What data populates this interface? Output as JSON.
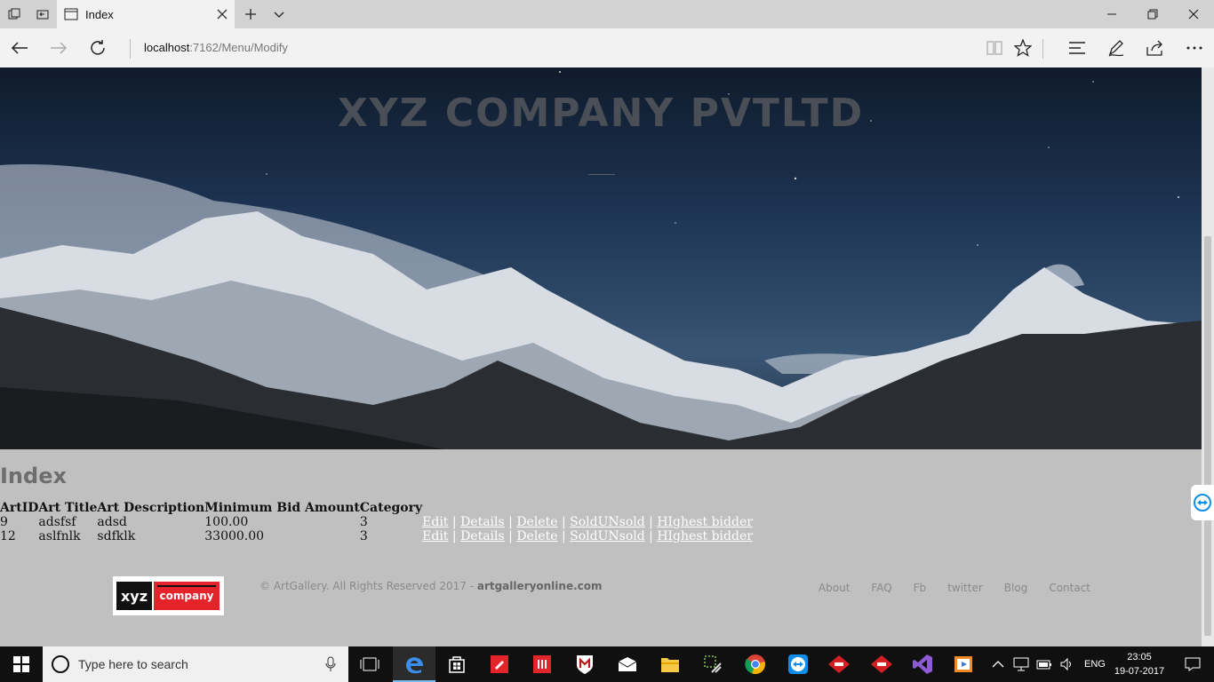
{
  "browser": {
    "tab_title": "Index",
    "address_host": "localhost",
    "address_path": ":7162/Menu/Modify"
  },
  "hero": {
    "title": "XYZ COMPANY PVTLTD"
  },
  "page": {
    "heading": "Index"
  },
  "table": {
    "headers": [
      "ArtID",
      "Art Title",
      "Art Description",
      "Minimum Bid Amount",
      "Category"
    ],
    "rows": [
      {
        "id": "9",
        "title": "adsfsf",
        "description": "adsd",
        "min_bid": "100.00",
        "category": "3"
      },
      {
        "id": "12",
        "title": "aslfnlk",
        "description": "sdfklk",
        "min_bid": "33000.00",
        "category": "3"
      }
    ],
    "actions": [
      "Edit",
      "Details",
      "Delete",
      "SoldUNsold",
      "HIghest bidder"
    ],
    "action_separator": "|"
  },
  "footer": {
    "logo_left": "xyz",
    "logo_right": "company",
    "copyright_prefix": "© ArtGallery. All Rights Reserved 2017 - ",
    "copyright_site": "artgalleryonline.com",
    "links": [
      "About",
      "FAQ",
      "Fb",
      "twitter",
      "Blog",
      "Contact"
    ]
  },
  "taskbar": {
    "search_placeholder": "Type here to search",
    "language": "ENG",
    "time": "23:05",
    "date": "19-07-2017"
  },
  "colors": {
    "link": "#ffffff",
    "page_bg": "#c0c0c0",
    "taskbar_bg": "#101010",
    "logo_red": "#e6222a"
  }
}
